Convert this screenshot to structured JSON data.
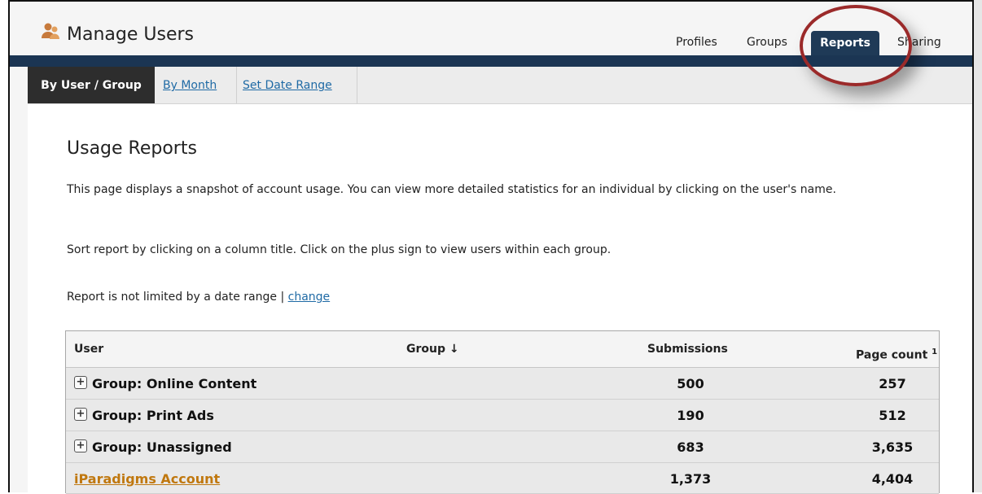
{
  "app": {
    "title": "Manage Users"
  },
  "nav": {
    "profiles": "Profiles",
    "groups": "Groups",
    "reports": "Reports",
    "sharing": "Sharing"
  },
  "subtabs": {
    "by_user_group": "By User / Group",
    "by_month": "By Month",
    "set_date_range": "Set Date Range"
  },
  "page": {
    "heading": "Usage Reports",
    "description": "This page displays a snapshot of account usage. You can view more detailed statistics for an individual by clicking on the user's name.",
    "sort_hint": "Sort report by clicking on a column title. Click on the plus sign to view users within each group.",
    "date_range_text": "Report is not limited by a date range | ",
    "change_link": "change"
  },
  "table": {
    "headers": {
      "user": "User",
      "group": "Group ↓",
      "submissions": "Submissions",
      "page_count": "Page count",
      "page_count_footnote": "1"
    },
    "rows": [
      {
        "label": "Group: Online Content",
        "submissions": "500",
        "page_count": "257"
      },
      {
        "label": "Group: Print Ads",
        "submissions": "190",
        "page_count": "512"
      },
      {
        "label": "Group: Unassigned",
        "submissions": "683",
        "page_count": "3,635"
      },
      {
        "label": "iParadigms Account",
        "submissions": "1,373",
        "page_count": "4,404"
      }
    ],
    "expand_symbol": "+"
  },
  "colors": {
    "navy": "#1b3553",
    "active_tab": "#1f3a57",
    "link": "#1f6aa5",
    "account_link": "#c0780f",
    "highlight": "#9b2a2a"
  },
  "icons": {
    "app_logo": "user-icon",
    "expand": "plus-icon"
  }
}
